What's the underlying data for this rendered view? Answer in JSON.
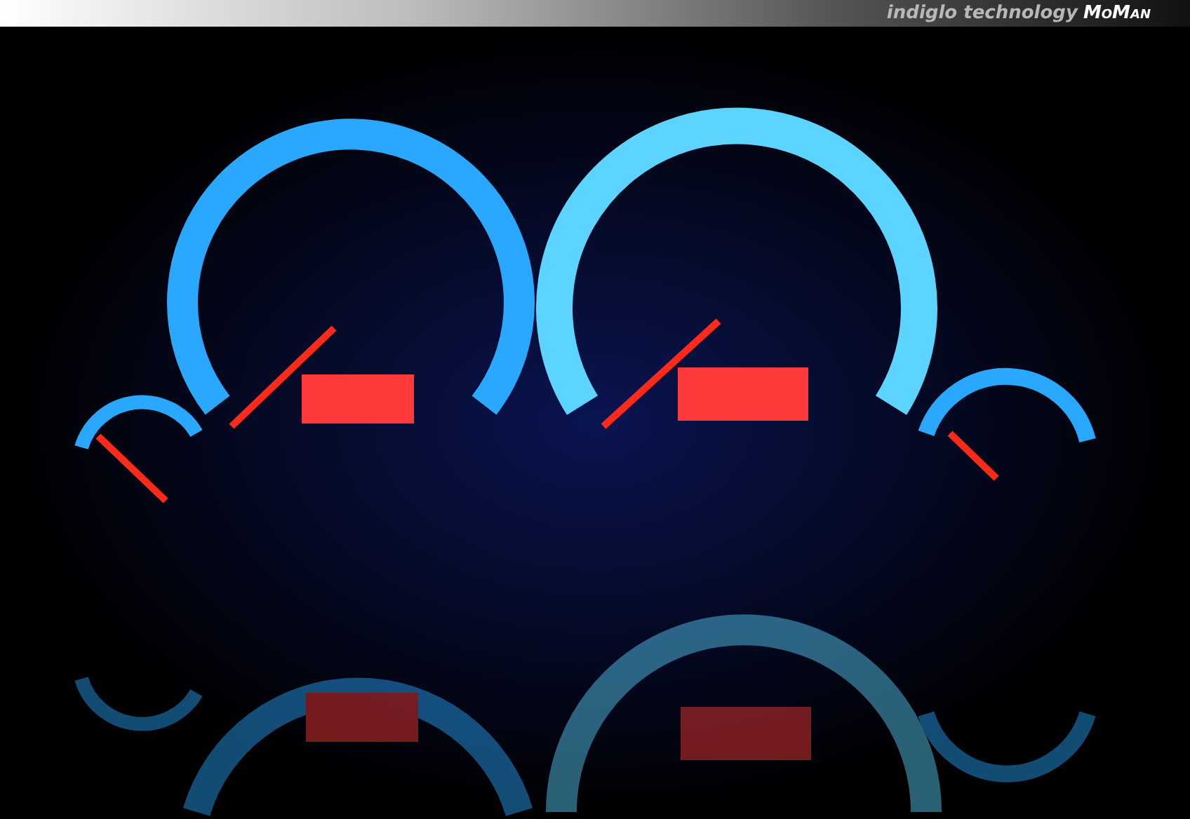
{
  "header": {
    "tagline": "indiglo technology",
    "brand": "MoMan"
  }
}
